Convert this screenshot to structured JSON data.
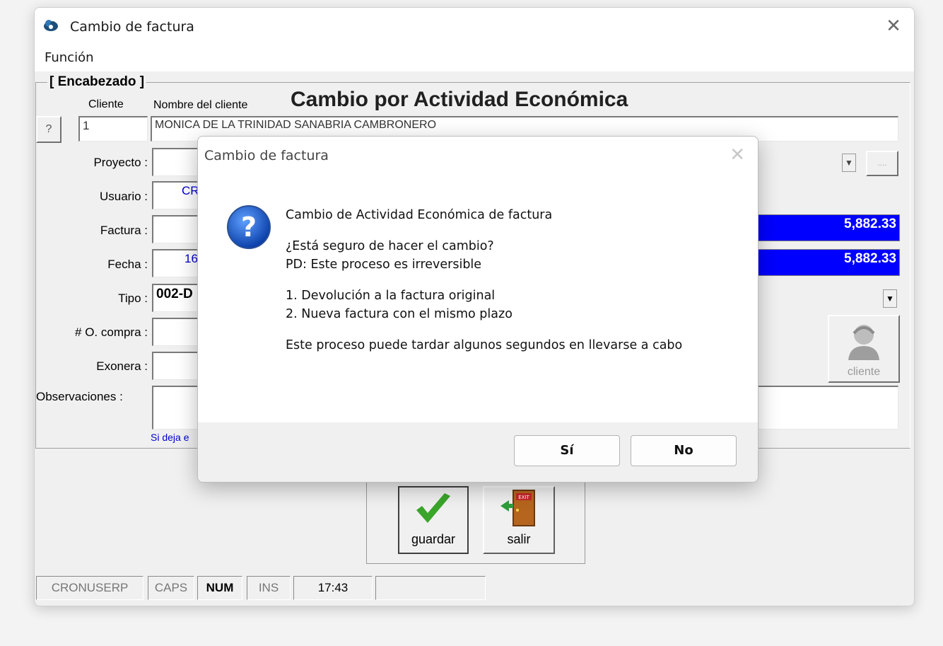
{
  "window": {
    "title": "Cambio de factura",
    "close": "✕"
  },
  "menu": {
    "funcion": "Función"
  },
  "header": {
    "legend": "[ Encabezado ]",
    "banner": "Cambio por Actividad Económica",
    "cliente_label": "Cliente",
    "nombre_label": "Nombre del cliente",
    "lookup_btn": "?",
    "cliente_value": "1",
    "nombre_value": "MONICA DE LA TRINIDAD SANABRIA CAMBRONERO",
    "proyecto_label": "Proyecto :",
    "usuario_label": "Usuario :",
    "usuario_value": "CR",
    "factura_label": "Factura :",
    "fecha_label": "Fecha :",
    "fecha_value": "16",
    "tipo_label": "Tipo :",
    "tipo_value": "002-D",
    "ocompra_label": "# O. compra :",
    "exonera_label": "Exonera :",
    "observaciones_label": "Observaciones :",
    "hint": "Si deja e",
    "total1": "5,882.33",
    "total2": "5,882.33",
    "ellipsis_btn": "....",
    "cliente_btn": "cliente"
  },
  "actions": {
    "guardar": "guardar",
    "salir": "salir"
  },
  "statusbar": {
    "app": "CRONUSERP",
    "caps": "CAPS",
    "num": "NUM",
    "ins": "INS",
    "time": "17:43"
  },
  "dialog": {
    "title": "Cambio de factura",
    "close": "✕",
    "line1": "Cambio de Actividad Económica de factura",
    "line2": "¿Está seguro de hacer el cambio?",
    "line3": "PD: Este proceso es irreversible",
    "line4": "1. Devolución a la factura original",
    "line5": "2. Nueva factura con el mismo plazo",
    "line6": "Este proceso puede tardar algunos segundos en llevarse a cabo",
    "yes": "Sí",
    "no": "No"
  },
  "colors": {
    "total_bg": "#0000ff",
    "accent_blue": "#0000c8",
    "check_green": "#3aa52a"
  }
}
